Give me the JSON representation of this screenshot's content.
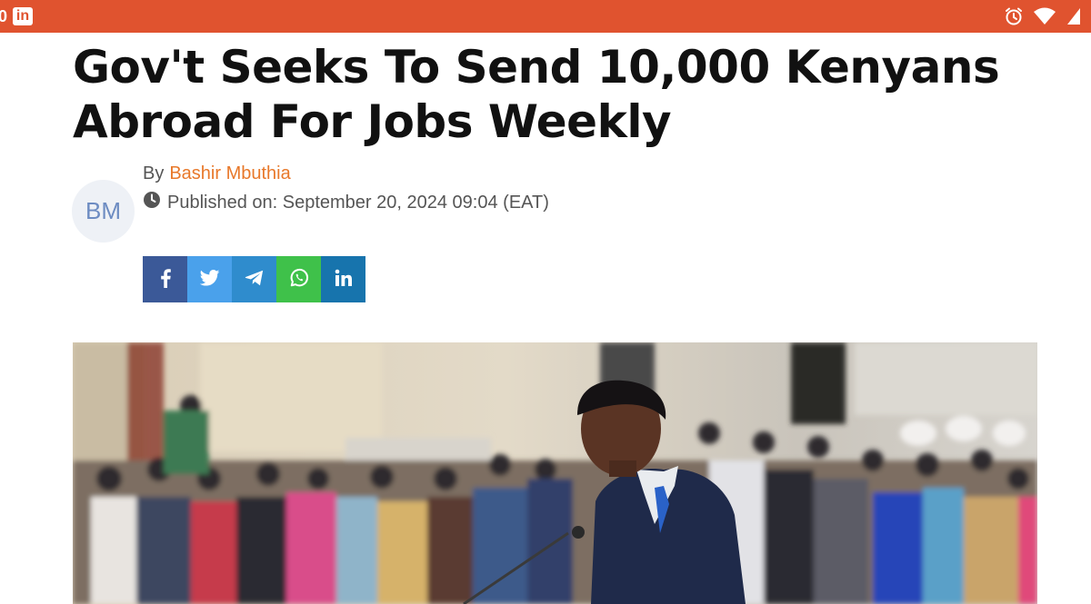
{
  "statusbar": {
    "notification_count": "0",
    "app_icon": "linkedin-icon",
    "app_icon_text": "in",
    "right_icons": [
      "alarm-icon",
      "wifi-icon",
      "battery-icon"
    ]
  },
  "article": {
    "headline": "Gov't Seeks To Send 10,000 Kenyans Abroad For Jobs Weekly",
    "author_initials": "BM",
    "byline_prefix": "By",
    "author_name": "Bashir Mbuthia",
    "published_label": "Published on: September 20, 2024 09:04 (EAT)"
  },
  "share_buttons": [
    {
      "network": "facebook",
      "icon": "facebook-icon"
    },
    {
      "network": "twitter",
      "icon": "twitter-icon"
    },
    {
      "network": "telegram",
      "icon": "telegram-icon"
    },
    {
      "network": "whatsapp",
      "icon": "whatsapp-icon"
    },
    {
      "network": "linkedin",
      "icon": "linkedin-icon",
      "text": "in"
    }
  ],
  "colors": {
    "statusbar": "#e0532f",
    "author_link": "#e8782a",
    "facebook": "#3b5998",
    "twitter": "#4aa1eb",
    "telegram": "#2f8ccd",
    "whatsapp": "#3fc14a",
    "linkedin": "#1774ad"
  },
  "hero_image": {
    "subject": "photo"
  }
}
